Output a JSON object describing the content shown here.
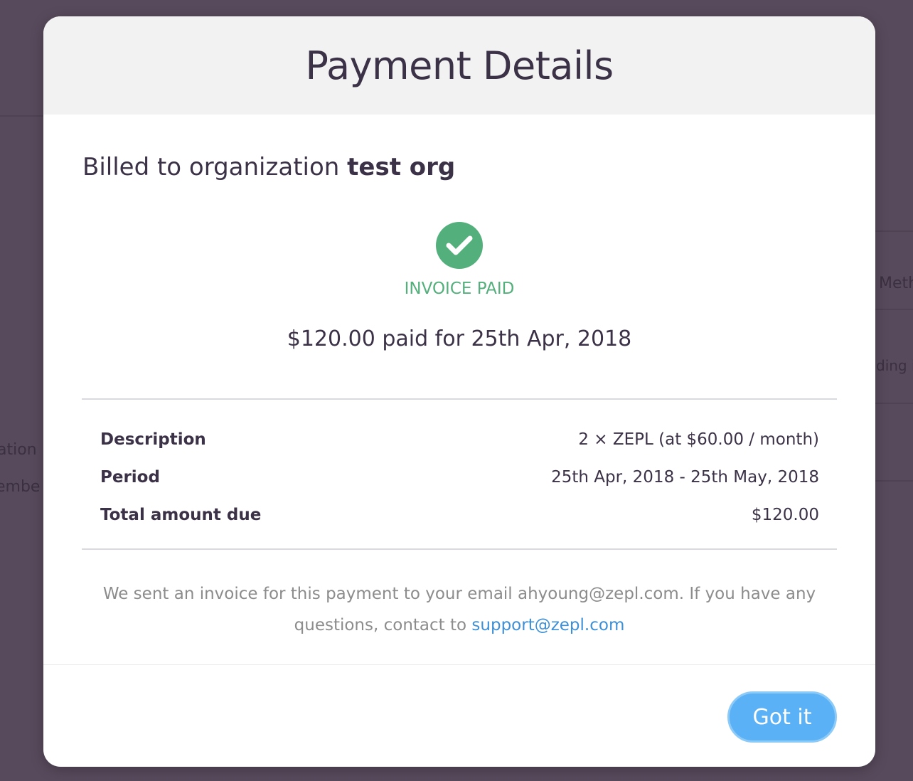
{
  "background": {
    "fragment_1": "ation",
    "fragment_2": "embe",
    "fragment_3": "Meth",
    "fragment_4": "ding i"
  },
  "modal": {
    "title": "Payment Details",
    "billed_prefix": "Billed to organization",
    "billed_org": "test org",
    "status": "INVOICE PAID",
    "paid_summary": "$120.00 paid for 25th Apr, 2018",
    "details": [
      {
        "key": "Description",
        "value": "2 × ZEPL (at $60.00 / month)"
      },
      {
        "key": "Period",
        "value": "25th Apr, 2018 - 25th May, 2018"
      },
      {
        "key": "Total amount due",
        "value": "$120.00"
      }
    ],
    "note_text": "We sent an invoice for this payment to your email ahyoung@zepl.com. If you have any questions, contact to",
    "support_email": "support@zepl.com",
    "button_label": "Got it"
  },
  "colors": {
    "overlay": "#574a5c",
    "success": "#53b07c",
    "accent": "#5bb1f5",
    "link": "#3d8fd6"
  },
  "icons": {
    "status_icon": "check-circle-icon"
  }
}
